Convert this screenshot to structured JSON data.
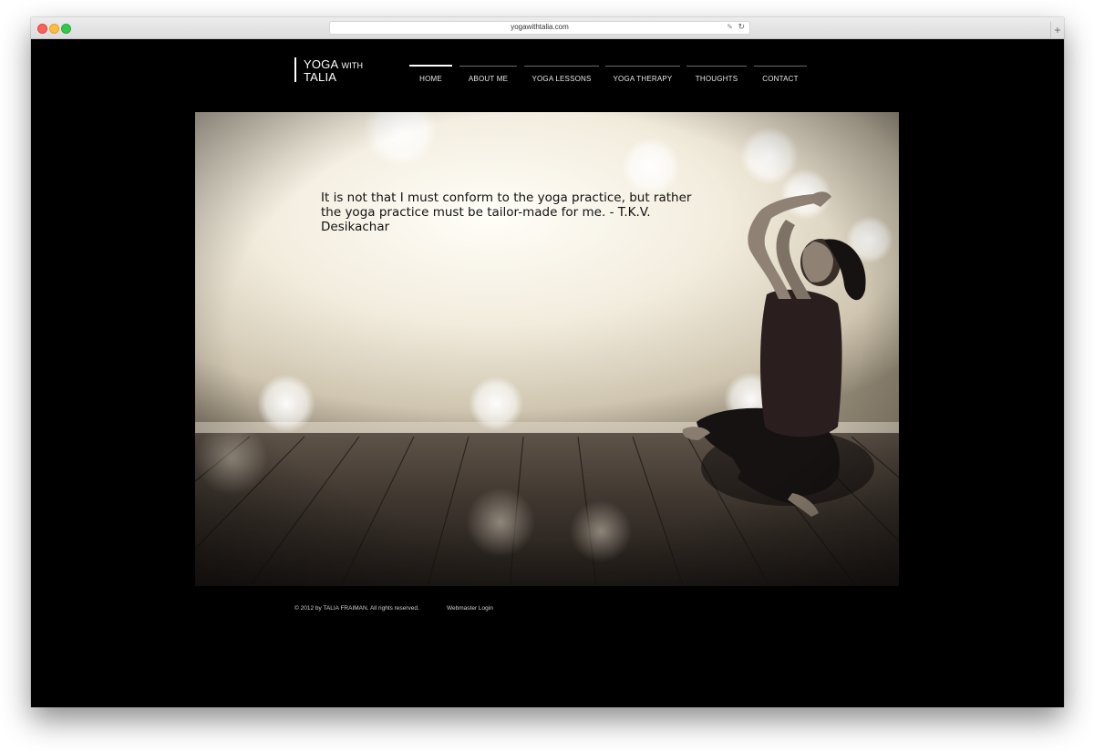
{
  "browser": {
    "url": "yogawithtalia.com"
  },
  "logo": {
    "word1": "YOGA",
    "word2": "WITH",
    "word3": "TALIA"
  },
  "nav": {
    "items": [
      {
        "label": "HOME"
      },
      {
        "label": "ABOUT ME"
      },
      {
        "label": "YOGA LESSONS"
      },
      {
        "label": "YOGA THERAPY"
      },
      {
        "label": "THOUGHTS"
      },
      {
        "label": "CONTACT"
      }
    ]
  },
  "hero": {
    "quote": "It is not that I must conform to the yoga practice, but rather the yoga practice must be tailor-made for me. - T.K.V. Desikachar"
  },
  "footer": {
    "copyright": "© 2012 by TALIA FRAIMAN. All rights reserved.",
    "login": "Webmaster Login"
  }
}
